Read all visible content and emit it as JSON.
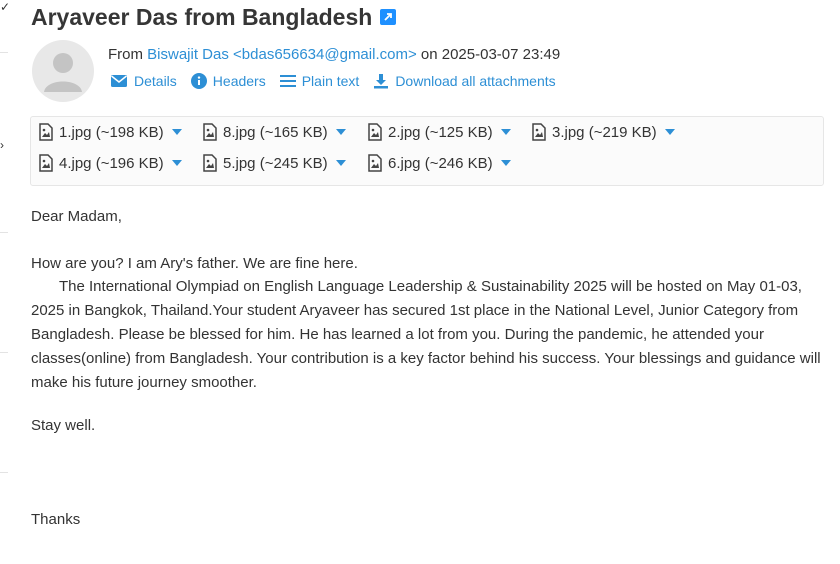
{
  "email": {
    "subject": "Aryaveer Das from Bangladesh",
    "from_prefix": "From",
    "sender_name": "Biswajit Das",
    "sender_email": "<bdas656634@gmail.com>",
    "date_prefix": "on",
    "date": "2025-03-07 23:49"
  },
  "actions": {
    "details": "Details",
    "headers": "Headers",
    "plain_text": "Plain text",
    "download_all": "Download all attachments"
  },
  "attachments": [
    {
      "name": "1.jpg",
      "size": "(~198 KB)"
    },
    {
      "name": "8.jpg",
      "size": "(~165 KB)"
    },
    {
      "name": "2.jpg",
      "size": "(~125 KB)"
    },
    {
      "name": "3.jpg",
      "size": "(~219 KB)"
    },
    {
      "name": "4.jpg",
      "size": "(~196 KB)"
    },
    {
      "name": "5.jpg",
      "size": "(~245 KB)"
    },
    {
      "name": "6.jpg",
      "size": "(~246 KB)"
    }
  ],
  "body": {
    "greeting": "Dear Madam,",
    "line1": "How are you? I am Ary's father. We are fine here.",
    "paragraph": "The International Olympiad on English Language Leadership & Sustainability 2025 will be hosted on May 01-03, 2025 in Bangkok, Thailand.Your student Aryaveer has secured 1st place in the National Level, Junior Category from Bangladesh. Please be blessed for him. He has learned a lot from you. During the pandemic, he attended your classes(online) from Bangladesh. Your contribution is a key factor behind his success. Your blessings and guidance will make his future journey smoother.",
    "closing1": "Stay well.",
    "closing2": "Thanks"
  },
  "colors": {
    "accent": "#2d8fd5",
    "subject": "#363636",
    "text": "#333333"
  },
  "icons": [
    "external-link-icon",
    "user-avatar-icon",
    "envelope-icon",
    "info-icon",
    "list-icon",
    "download-icon",
    "image-file-icon",
    "caret-down-icon"
  ]
}
